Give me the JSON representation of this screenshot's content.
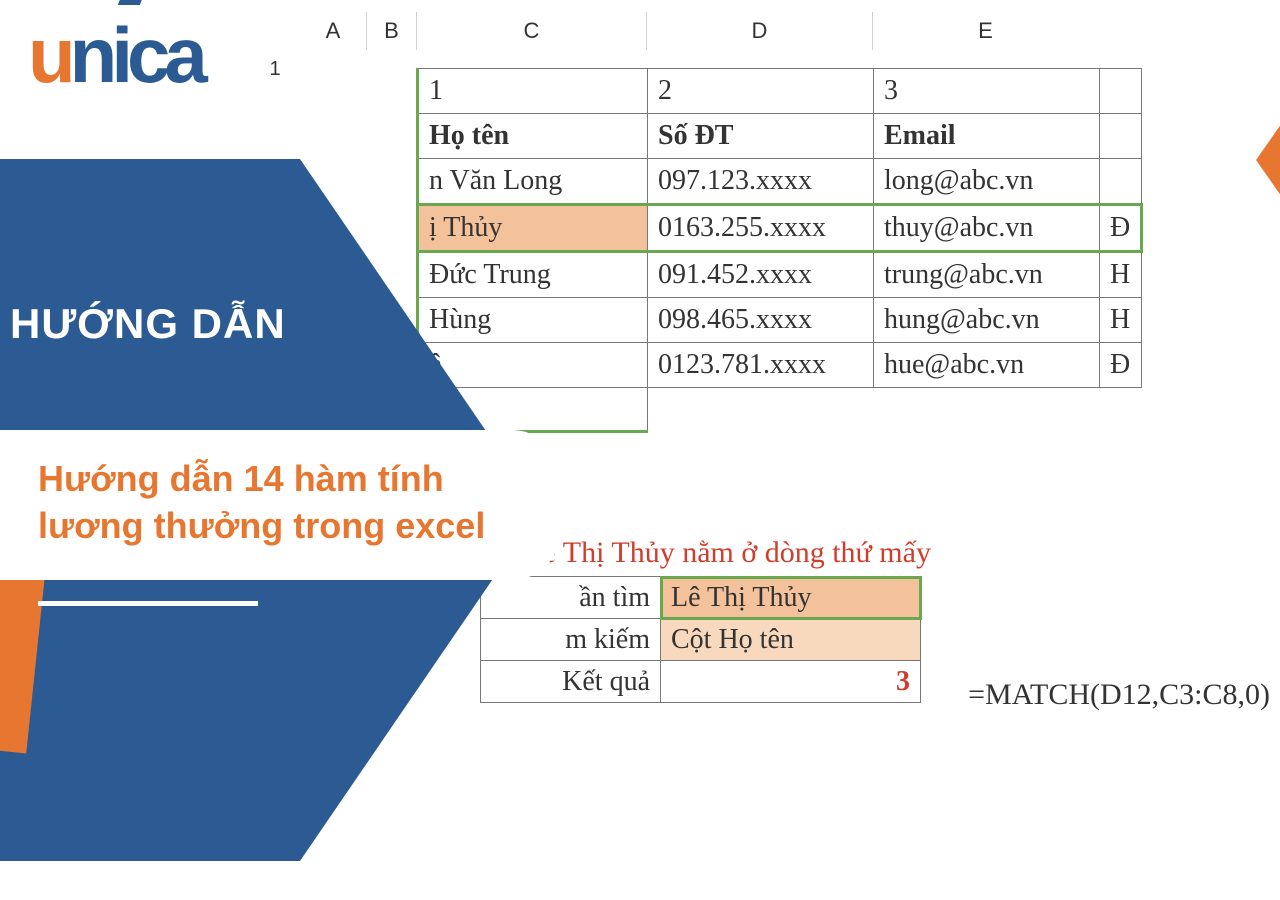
{
  "logo": {
    "u": "u",
    "n": "n",
    "i": "i",
    "c": "c",
    "a": "a"
  },
  "badge": {
    "guide": "HƯỚNG DẪN"
  },
  "subtitle_line1": "Hướng dẫn 14 hàm tính",
  "subtitle_line2": "lương thưởng trong excel",
  "columns": {
    "A": "A",
    "B": "B",
    "C": "C",
    "D": "D",
    "E": "E"
  },
  "row1": "1",
  "table": {
    "idx": {
      "c": "1",
      "d": "2",
      "e": "3"
    },
    "hdr": {
      "c": "Họ tên",
      "d": "Số ĐT",
      "e": "Email"
    },
    "r1": {
      "c": "n Văn Long",
      "d": "097.123.xxxx",
      "e": "long@abc.vn",
      "f": ""
    },
    "r2": {
      "c": "ị Thủy",
      "d": "0163.255.xxxx",
      "e": "thuy@abc.vn",
      "f": "Đ"
    },
    "r3": {
      "c": "Đức Trung",
      "d": "091.452.xxxx",
      "e": "trung@abc.vn",
      "f": "H"
    },
    "r4": {
      "c": "Hùng",
      "d": "098.465.xxxx",
      "e": "hung@abc.vn",
      "f": "H"
    },
    "r5": {
      "c": "ê",
      "d": "0123.781.xxxx",
      "e": "hue@abc.vn",
      "f": "Đ"
    }
  },
  "helper": {
    "question": "tên Lê Thị Thủy nằm ở dòng thứ mấy",
    "rows": {
      "find": {
        "lab": "ần tìm",
        "val": "Lê Thị Thủy"
      },
      "area": {
        "lab": "m kiếm",
        "val": "Cột Họ tên"
      },
      "res": {
        "lab": "Kết quả",
        "val": "3"
      }
    }
  },
  "formula": "=MATCH(D12,C3:C8,0)"
}
